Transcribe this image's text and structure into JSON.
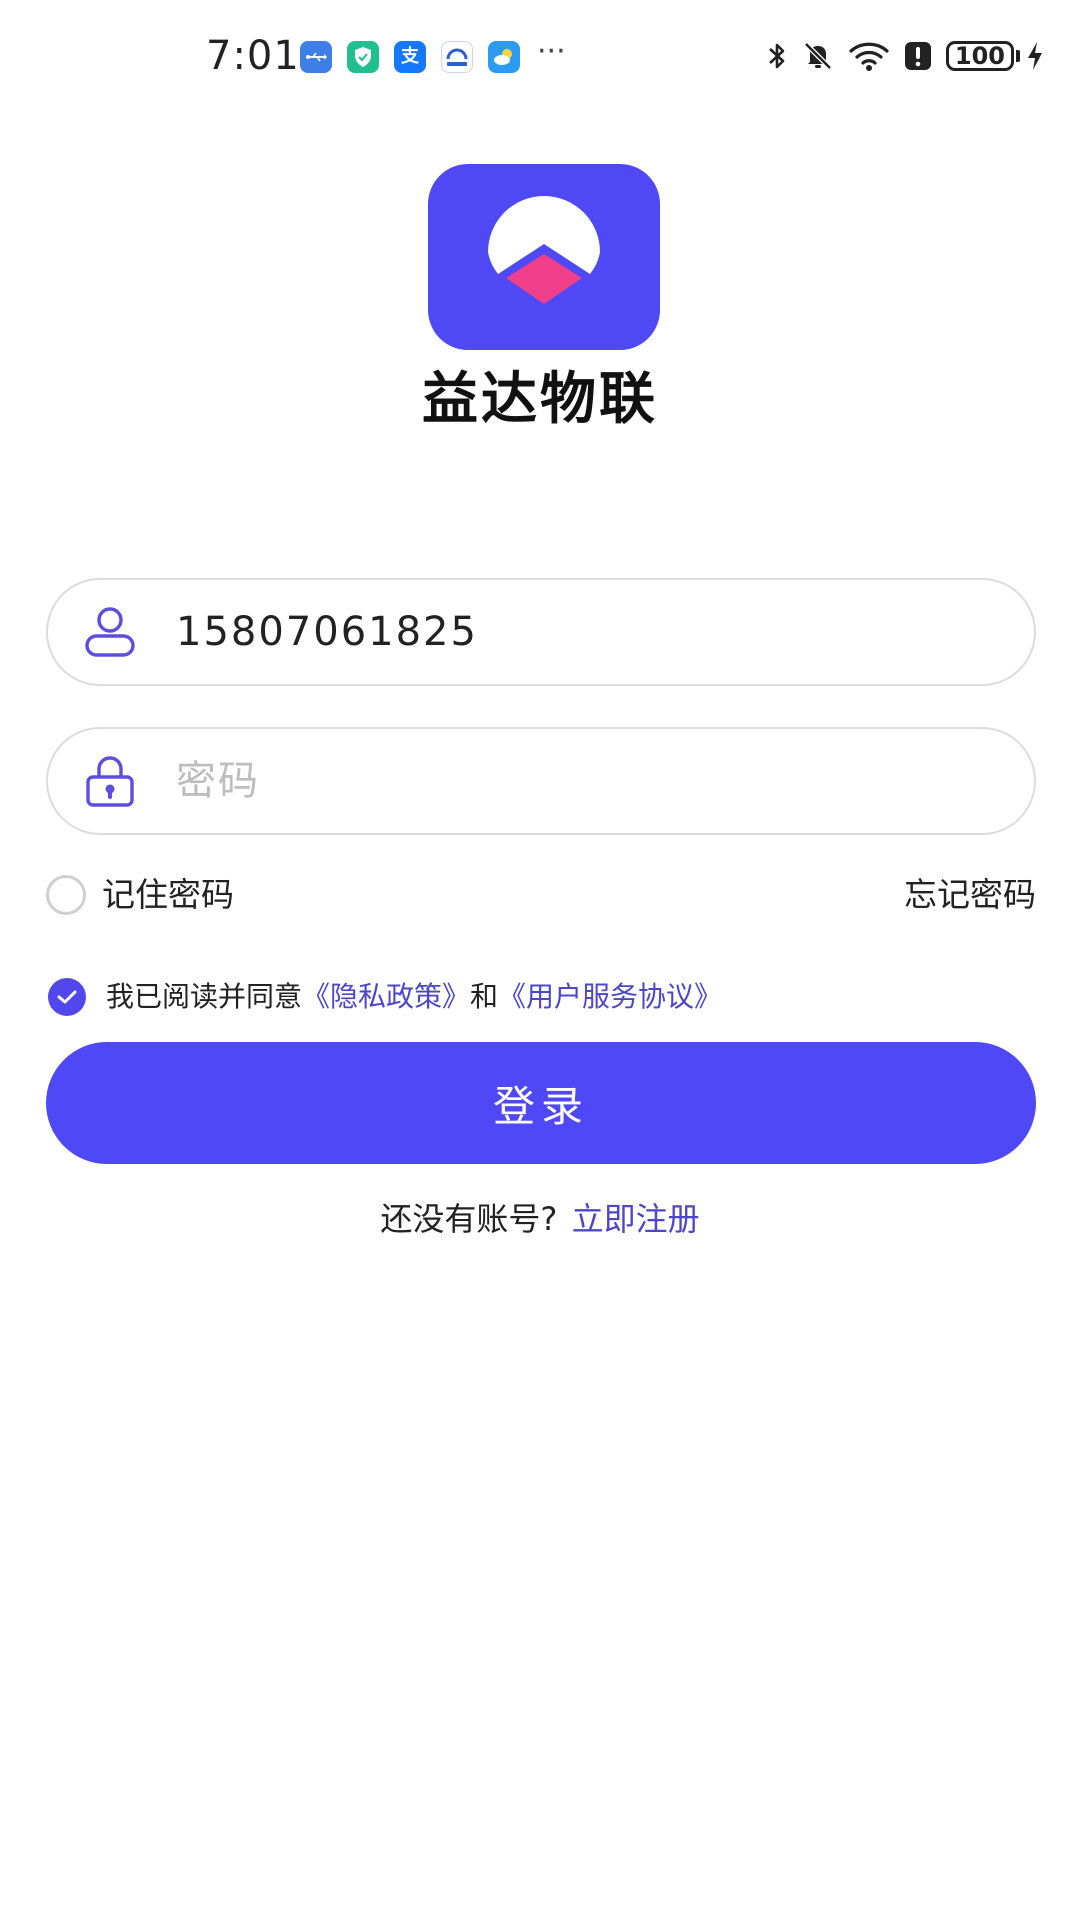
{
  "status_bar": {
    "time": "7:01",
    "notification_icons": [
      {
        "name": "usb-icon",
        "color": "#3c7fe6"
      },
      {
        "name": "security-shield-icon",
        "color": "#1fbf8f"
      },
      {
        "name": "alipay-icon",
        "color": "#1677ff",
        "glyph": "支"
      },
      {
        "name": "app-notification-icon",
        "color": "#2a5fd8"
      },
      {
        "name": "weather-icon",
        "color": "#2d9bf0"
      }
    ],
    "more_notifications": "···",
    "battery_level": "100"
  },
  "app": {
    "name": "益达物联",
    "brand_color": "#4f48f5"
  },
  "login_form": {
    "phone_value": "15807061825",
    "password_placeholder": "密码",
    "remember_label": "记住密码",
    "remember_checked": false,
    "forgot_label": "忘记密码",
    "agreement": {
      "checked": true,
      "prefix": "我已阅读并同意",
      "privacy_link": "《隐私政策》",
      "connector": "和",
      "terms_link": "《用户服务协议》"
    },
    "login_label": "登录",
    "register_prompt": "还没有账号?",
    "register_link": "立即注册"
  }
}
